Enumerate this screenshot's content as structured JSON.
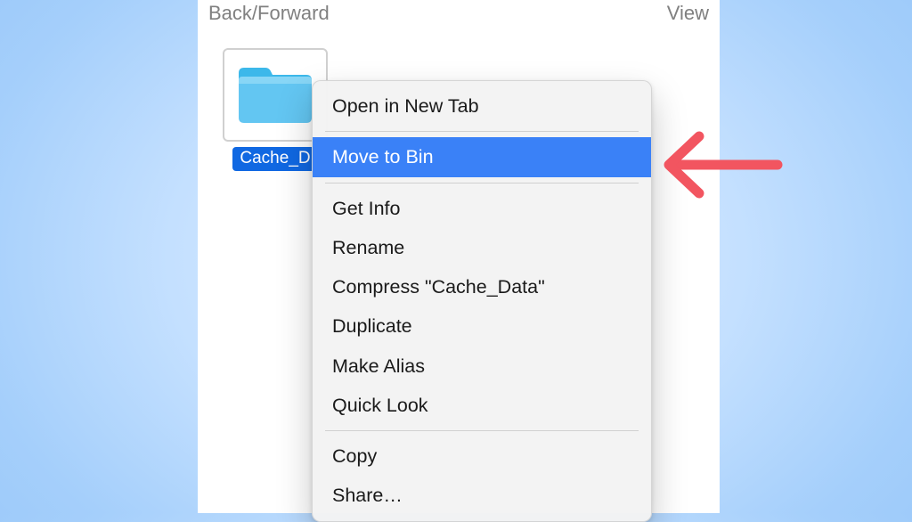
{
  "toolbar": {
    "back_forward_label": "Back/Forward",
    "view_label": "View"
  },
  "folder": {
    "name": "Cache_Data",
    "label_truncated": "Cache_D"
  },
  "context_menu": {
    "groups": [
      {
        "items": [
          {
            "label": "Open in New Tab",
            "highlighted": false
          }
        ]
      },
      {
        "items": [
          {
            "label": "Move to Bin",
            "highlighted": true
          }
        ]
      },
      {
        "items": [
          {
            "label": "Get Info",
            "highlighted": false
          },
          {
            "label": "Rename",
            "highlighted": false
          },
          {
            "label": "Compress \"Cache_Data\"",
            "highlighted": false
          },
          {
            "label": "Duplicate",
            "highlighted": false
          },
          {
            "label": "Make Alias",
            "highlighted": false
          },
          {
            "label": "Quick Look",
            "highlighted": false
          }
        ]
      },
      {
        "items": [
          {
            "label": "Copy",
            "highlighted": false
          },
          {
            "label": "Share…",
            "highlighted": false
          }
        ]
      }
    ]
  },
  "colors": {
    "highlight": "#3a81f7",
    "selection": "#1068e2",
    "arrow": "#f25560",
    "folder_light": "#63c6f2",
    "folder_dark": "#2ba7e1"
  }
}
